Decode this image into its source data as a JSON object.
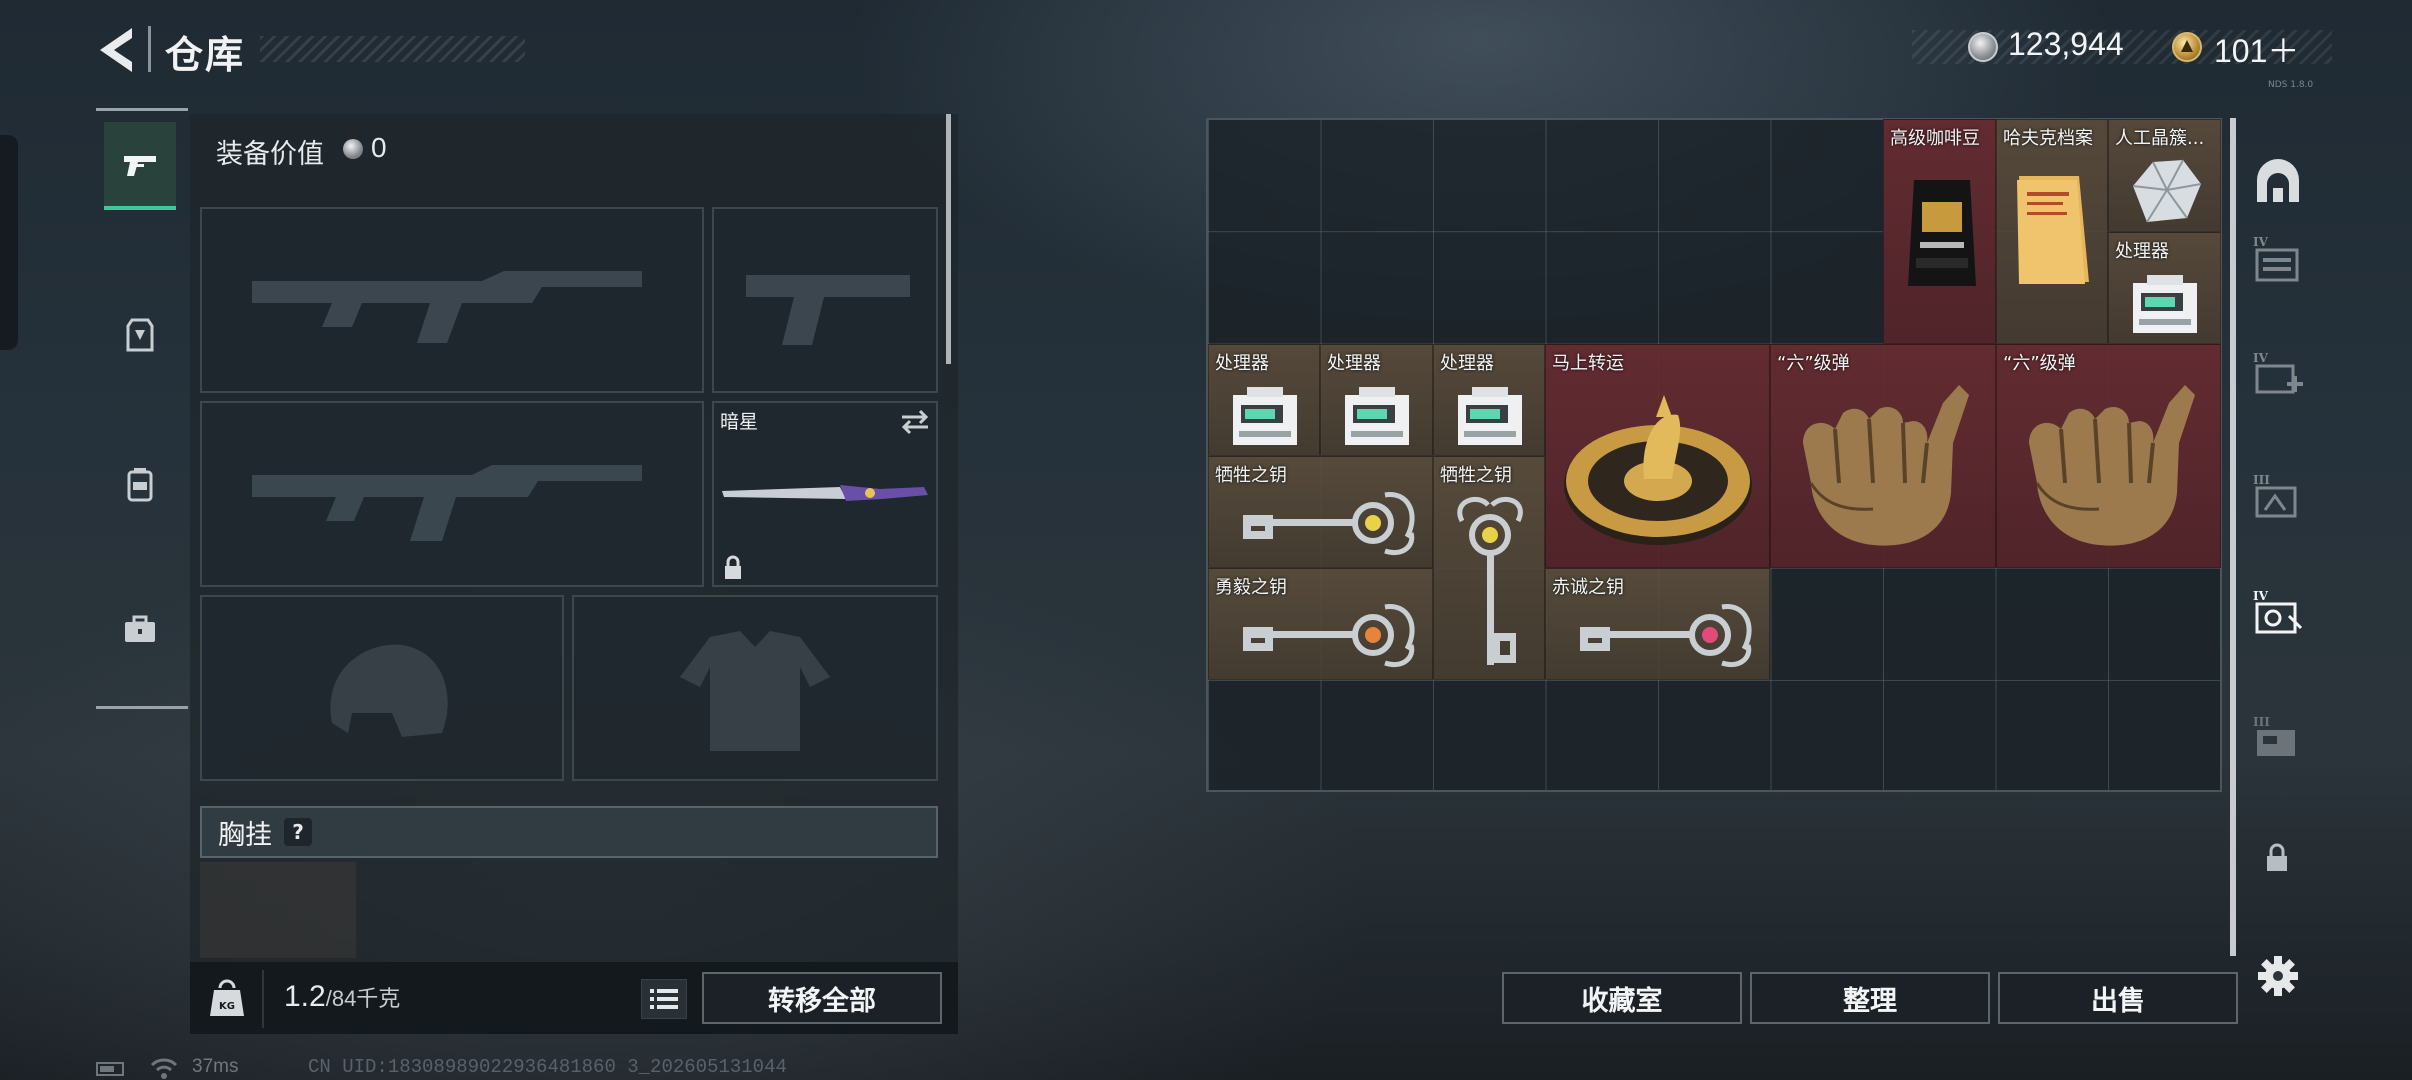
{
  "header": {
    "title": "仓库"
  },
  "currency": {
    "silver": "123,944",
    "gold": "101＋"
  },
  "version_text": "NDS 1.8.0",
  "rail": {
    "tabs": [
      {
        "name": "weapons",
        "icon": "pistol-icon",
        "active": true
      },
      {
        "name": "armor",
        "icon": "vest-icon",
        "active": false
      },
      {
        "name": "backpack",
        "icon": "bag-icon",
        "active": false
      },
      {
        "name": "case",
        "icon": "briefcase-icon",
        "active": false
      }
    ]
  },
  "loadout": {
    "equip_label": "装备价值",
    "equip_value": "0",
    "knife": {
      "name": "暗星"
    },
    "chest_label": "胸挂",
    "chest_help": "?",
    "weight": "1.2",
    "weight_max": "/84千克",
    "transfer_all": "转移全部"
  },
  "inventory": {
    "items": [
      {
        "name": "高级咖啡豆",
        "quality": "red",
        "icon": "coffee-bag-icon"
      },
      {
        "name": "哈夫克档案",
        "quality": "brown",
        "icon": "folder-icon"
      },
      {
        "name": "人工晶簇...",
        "quality": "brown",
        "icon": "crystal-icon"
      },
      {
        "name": "处理器",
        "quality": "brown",
        "icon": "processor-icon"
      },
      {
        "name": "处理器",
        "quality": "brown",
        "icon": "processor-icon"
      },
      {
        "name": "处理器",
        "quality": "brown",
        "icon": "processor-icon"
      },
      {
        "name": "处理器",
        "quality": "brown",
        "icon": "processor-icon"
      },
      {
        "name": "马上转运",
        "quality": "red",
        "icon": "horse-disc-icon"
      },
      {
        "name": "“六”级弹",
        "quality": "red",
        "icon": "hand-sign-icon"
      },
      {
        "name": "“六”级弹",
        "quality": "red",
        "icon": "hand-sign-icon"
      },
      {
        "name": "牺牲之钥",
        "quality": "brown",
        "icon": "key-icon"
      },
      {
        "name": "牺牲之钥",
        "quality": "brown",
        "icon": "key-icon"
      },
      {
        "name": "勇毅之钥",
        "quality": "brown",
        "icon": "key-icon"
      },
      {
        "name": "赤诚之钥",
        "quality": "brown",
        "icon": "key-icon"
      }
    ]
  },
  "actions": {
    "collection": "收藏室",
    "organize": "整理",
    "sell": "出售"
  },
  "category_tabs": [
    {
      "label": "collection-room",
      "icon": "dome-icon"
    },
    {
      "label": "IV",
      "icon": "tier-iv-storage-icon"
    },
    {
      "label": "IV",
      "icon": "tier-iv-medical-icon"
    },
    {
      "label": "III",
      "icon": "tier-iii-icon"
    },
    {
      "label": "IV",
      "icon": "tier-iv-safe-icon"
    },
    {
      "label": "III",
      "icon": "tier-iii-machine-icon"
    }
  ],
  "status": {
    "ping": "37ms",
    "uid": "CN UID:18308989022936481860 3_202605131044"
  },
  "colors": {
    "accent": "#3fc89c",
    "quality_red": "#6a2d33",
    "quality_brown": "#5e4f3e"
  }
}
